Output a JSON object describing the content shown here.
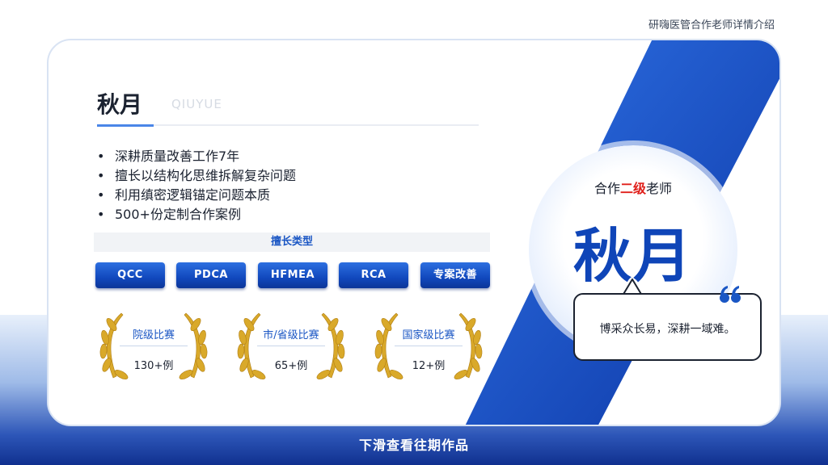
{
  "header": {
    "label": "研嗨医管合作老师详情介绍"
  },
  "teacher": {
    "name": "秋月",
    "pinyin": "QIUYUE"
  },
  "bullets": [
    "深耕质量改善工作7年",
    "擅长以结构化思维拆解复杂问题",
    "利用缜密逻辑锚定问题本质",
    "500+份定制合作案例"
  ],
  "specialty": {
    "title": "擅长类型",
    "tags": [
      "QCC",
      "PDCA",
      "HFMEA",
      "RCA",
      "专案改善"
    ]
  },
  "awards": [
    {
      "title": "院级比赛",
      "count": "130+例"
    },
    {
      "title": "市/省级比赛",
      "count": "65+例"
    },
    {
      "title": "国家级比赛",
      "count": "12+例"
    }
  ],
  "badge": {
    "prefix": "合作",
    "level": "二级",
    "suffix": "老师",
    "name": "秋月"
  },
  "quote": {
    "text": "博采众长易，深耕一域难。"
  },
  "footer": {
    "caption": "下滑查看往期作品"
  },
  "colors": {
    "accent_blue": "#0f45b8",
    "highlight_red": "#e0201b"
  },
  "icons": [
    "laurel-wreath-icon",
    "quote-icon"
  ]
}
